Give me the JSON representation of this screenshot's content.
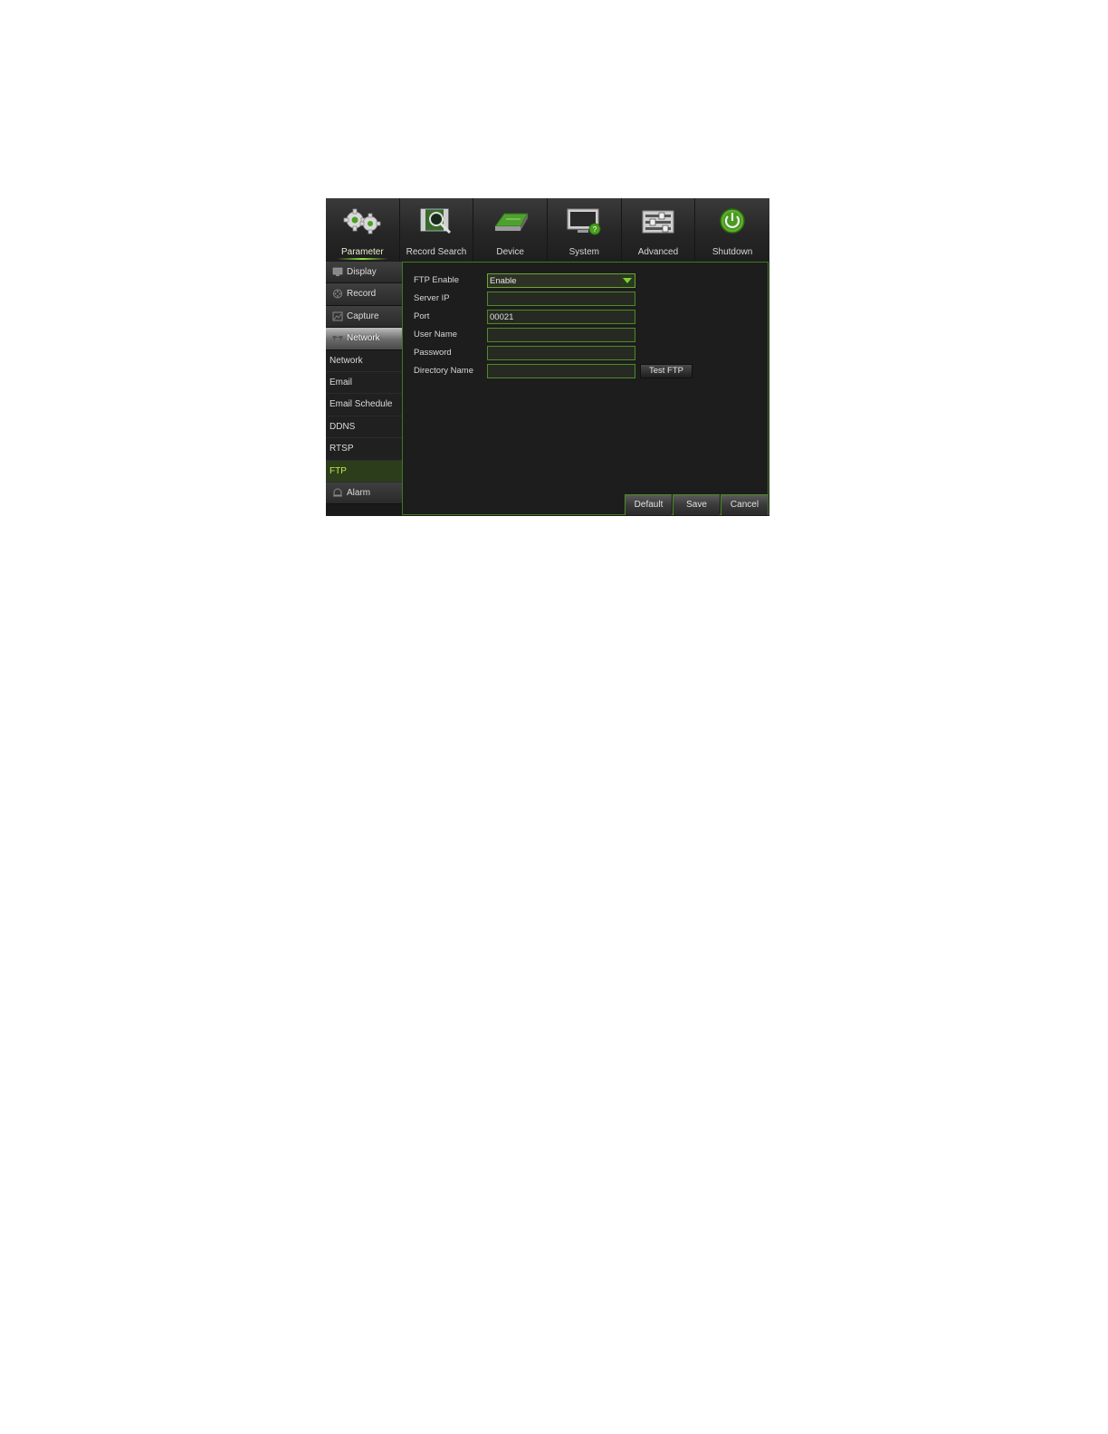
{
  "toolbar": {
    "items": [
      {
        "label": "Parameter",
        "icon": "gears-icon"
      },
      {
        "label": "Record Search",
        "icon": "record-search-icon"
      },
      {
        "label": "Device",
        "icon": "hard-drive-icon"
      },
      {
        "label": "System",
        "icon": "system-monitor-icon"
      },
      {
        "label": "Advanced",
        "icon": "advanced-sliders-icon"
      },
      {
        "label": "Shutdown",
        "icon": "power-icon"
      }
    ],
    "active_index": 0
  },
  "sidebar": {
    "display_label": "Display",
    "record_label": "Record",
    "capture_label": "Capture",
    "network_label": "Network",
    "network_sub": {
      "network": "Network",
      "email": "Email",
      "email_schedule": "Email Schedule",
      "ddns": "DDNS",
      "rtsp": "RTSP",
      "ftp": "FTP"
    },
    "alarm_label": "Alarm",
    "active_sub": "FTP"
  },
  "form": {
    "ftp_enable": {
      "label": "FTP Enable",
      "value": "Enable"
    },
    "server_ip": {
      "label": "Server IP",
      "value": ""
    },
    "port": {
      "label": "Port",
      "value": "00021"
    },
    "user_name": {
      "label": "User Name",
      "value": ""
    },
    "password": {
      "label": "Password",
      "value": ""
    },
    "directory_name": {
      "label": "Directory Name",
      "value": ""
    },
    "test_ftp_label": "Test FTP"
  },
  "buttons": {
    "default_label": "Default",
    "save_label": "Save",
    "cancel_label": "Cancel"
  },
  "colors": {
    "accent_green": "#6aa830",
    "active_text": "#c6e84a",
    "panel_background": "#1d1d1d"
  }
}
